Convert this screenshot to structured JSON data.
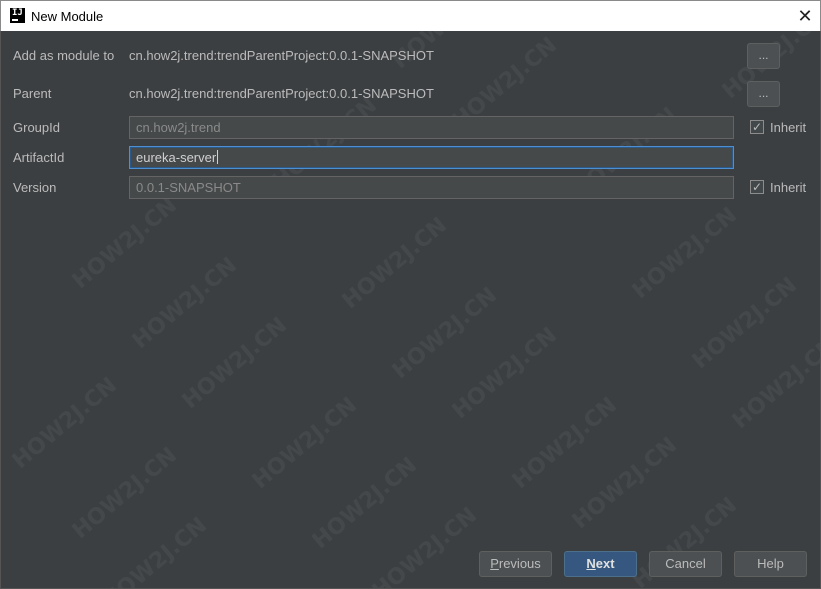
{
  "window": {
    "title": "New Module",
    "close_glyph": "✕",
    "icon_text": "IJ"
  },
  "form": {
    "add_as_module_label": "Add as module to",
    "add_as_module_value": "cn.how2j.trend:trendParentProject:0.0.1-SNAPSHOT",
    "parent_label": "Parent",
    "parent_value": "cn.how2j.trend:trendParentProject:0.0.1-SNAPSHOT",
    "browse_label": "...",
    "group_id_label": "GroupId",
    "group_id_value": "cn.how2j.trend",
    "artifact_id_label": "ArtifactId",
    "artifact_id_value": "eureka-server",
    "version_label": "Version",
    "version_value": "0.0.1-SNAPSHOT",
    "inherit_label": "Inherit",
    "group_inherit_checked": true,
    "version_inherit_checked": true
  },
  "buttons": {
    "previous_mnemonic": "P",
    "previous_rest": "revious",
    "next_mnemonic": "N",
    "next_rest": "ext",
    "cancel": "Cancel",
    "help": "Help"
  },
  "watermark": "HOW2J.CN",
  "colors": {
    "background": "#3c3f41",
    "primary_button": "#365880",
    "focus_border": "#4d8fd1"
  }
}
